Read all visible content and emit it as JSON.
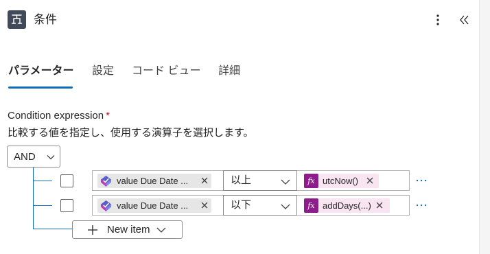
{
  "header": {
    "title": "条件",
    "icon": "condition-icon"
  },
  "tabs": [
    {
      "label": "パラメーター",
      "active": true
    },
    {
      "label": "設定",
      "active": false
    },
    {
      "label": "コード ビュー",
      "active": false
    },
    {
      "label": "詳細",
      "active": false
    }
  ],
  "condition": {
    "label": "Condition expression",
    "required_mark": "*",
    "description": "比較する値を指定し、使用する演算子を選択します。",
    "group_operator": "AND",
    "rows": [
      {
        "checked": false,
        "left_value": "value Due Date ...",
        "operator": "以上",
        "right_value": "utcNow()"
      },
      {
        "checked": false,
        "left_value": "value Due Date ...",
        "operator": "以下",
        "right_value": "addDays(...)"
      }
    ]
  },
  "new_item": {
    "label": "New item"
  },
  "colors": {
    "accent": "#0f6cbd",
    "fx_bg": "#8e1d8b",
    "fx_token_bg": "#f9e5f2",
    "token_bg": "#e6e6e6",
    "required": "#c50f1f"
  }
}
